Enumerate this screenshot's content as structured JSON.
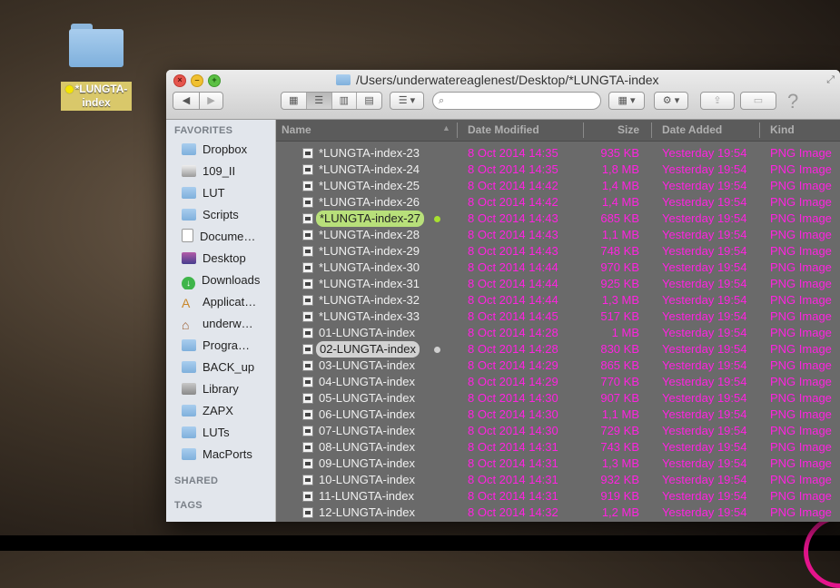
{
  "desktop": {
    "icon_label": "*LUNGTA-index"
  },
  "window": {
    "title": "/Users/underwatereaglenest/Desktop/*LUNGTA-index",
    "search_placeholder": ""
  },
  "sidebar": {
    "favorites_header": "FAVORITES",
    "shared_header": "SHARED",
    "tags_header": "TAGS",
    "items": [
      {
        "label": "Dropbox",
        "icon": "folder-icon"
      },
      {
        "label": "109_II",
        "icon": "disk-icon"
      },
      {
        "label": "LUT",
        "icon": "folder-icon"
      },
      {
        "label": "Scripts",
        "icon": "folder-icon"
      },
      {
        "label": "Docume…",
        "icon": "document-icon"
      },
      {
        "label": "Desktop",
        "icon": "desktop-icon"
      },
      {
        "label": "Downloads",
        "icon": "download-icon"
      },
      {
        "label": "Applicat…",
        "icon": "applications-icon"
      },
      {
        "label": "underw…",
        "icon": "home-icon"
      },
      {
        "label": "Progra…",
        "icon": "folder-icon"
      },
      {
        "label": "BACK_up",
        "icon": "folder-icon"
      },
      {
        "label": "Library",
        "icon": "library-icon"
      },
      {
        "label": "ZAPX",
        "icon": "folder-icon"
      },
      {
        "label": "LUTs",
        "icon": "folder-icon"
      },
      {
        "label": "MacPorts",
        "icon": "folder-icon"
      }
    ]
  },
  "columns": {
    "name": "Name",
    "date_modified": "Date Modified",
    "size": "Size",
    "date_added": "Date Added",
    "kind": "Kind"
  },
  "files": [
    {
      "name": "*LUNGTA-index-23",
      "date": "8 Oct 2014 14:35",
      "size": "935 KB",
      "added": "Yesterday 19:54",
      "kind": "PNG Image"
    },
    {
      "name": "*LUNGTA-index-24",
      "date": "8 Oct 2014 14:35",
      "size": "1,8 MB",
      "added": "Yesterday 19:54",
      "kind": "PNG Image"
    },
    {
      "name": "*LUNGTA-index-25",
      "date": "8 Oct 2014 14:42",
      "size": "1,4 MB",
      "added": "Yesterday 19:54",
      "kind": "PNG Image"
    },
    {
      "name": "*LUNGTA-index-26",
      "date": "8 Oct 2014 14:42",
      "size": "1,4 MB",
      "added": "Yesterday 19:54",
      "kind": "PNG Image"
    },
    {
      "name": "*LUNGTA-index-27",
      "date": "8 Oct 2014 14:43",
      "size": "685 KB",
      "added": "Yesterday 19:54",
      "kind": "PNG Image",
      "highlight": "green"
    },
    {
      "name": "*LUNGTA-index-28",
      "date": "8 Oct 2014 14:43",
      "size": "1,1 MB",
      "added": "Yesterday 19:54",
      "kind": "PNG Image"
    },
    {
      "name": "*LUNGTA-index-29",
      "date": "8 Oct 2014 14:43",
      "size": "748 KB",
      "added": "Yesterday 19:54",
      "kind": "PNG Image"
    },
    {
      "name": "*LUNGTA-index-30",
      "date": "8 Oct 2014 14:44",
      "size": "970 KB",
      "added": "Yesterday 19:54",
      "kind": "PNG Image"
    },
    {
      "name": "*LUNGTA-index-31",
      "date": "8 Oct 2014 14:44",
      "size": "925 KB",
      "added": "Yesterday 19:54",
      "kind": "PNG Image"
    },
    {
      "name": "*LUNGTA-index-32",
      "date": "8 Oct 2014 14:44",
      "size": "1,3 MB",
      "added": "Yesterday 19:54",
      "kind": "PNG Image"
    },
    {
      "name": "*LUNGTA-index-33",
      "date": "8 Oct 2014 14:45",
      "size": "517 KB",
      "added": "Yesterday 19:54",
      "kind": "PNG Image"
    },
    {
      "name": "01-LUNGTA-index",
      "date": "8 Oct 2014 14:28",
      "size": "1 MB",
      "added": "Yesterday 19:54",
      "kind": "PNG Image"
    },
    {
      "name": "02-LUNGTA-index",
      "date": "8 Oct 2014 14:28",
      "size": "830 KB",
      "added": "Yesterday 19:54",
      "kind": "PNG Image",
      "highlight": "gray"
    },
    {
      "name": "03-LUNGTA-index",
      "date": "8 Oct 2014 14:29",
      "size": "865 KB",
      "added": "Yesterday 19:54",
      "kind": "PNG Image"
    },
    {
      "name": "04-LUNGTA-index",
      "date": "8 Oct 2014 14:29",
      "size": "770 KB",
      "added": "Yesterday 19:54",
      "kind": "PNG Image"
    },
    {
      "name": "05-LUNGTA-index",
      "date": "8 Oct 2014 14:30",
      "size": "907 KB",
      "added": "Yesterday 19:54",
      "kind": "PNG Image"
    },
    {
      "name": "06-LUNGTA-index",
      "date": "8 Oct 2014 14:30",
      "size": "1,1 MB",
      "added": "Yesterday 19:54",
      "kind": "PNG Image"
    },
    {
      "name": "07-LUNGTA-index",
      "date": "8 Oct 2014 14:30",
      "size": "729 KB",
      "added": "Yesterday 19:54",
      "kind": "PNG Image"
    },
    {
      "name": "08-LUNGTA-index",
      "date": "8 Oct 2014 14:31",
      "size": "743 KB",
      "added": "Yesterday 19:54",
      "kind": "PNG Image"
    },
    {
      "name": "09-LUNGTA-index",
      "date": "8 Oct 2014 14:31",
      "size": "1,3 MB",
      "added": "Yesterday 19:54",
      "kind": "PNG Image"
    },
    {
      "name": "10-LUNGTA-index",
      "date": "8 Oct 2014 14:31",
      "size": "932 KB",
      "added": "Yesterday 19:54",
      "kind": "PNG Image"
    },
    {
      "name": "11-LUNGTA-index",
      "date": "8 Oct 2014 14:31",
      "size": "919 KB",
      "added": "Yesterday 19:54",
      "kind": "PNG Image"
    },
    {
      "name": "12-LUNGTA-index",
      "date": "8 Oct 2014 14:32",
      "size": "1,2 MB",
      "added": "Yesterday 19:54",
      "kind": "PNG Image"
    }
  ],
  "colors": {
    "metadata_text": "#ff22e0",
    "green_tag": "#b8e07a",
    "gray_tag": "#d2d2d2",
    "list_background": "#6a6a6a"
  }
}
